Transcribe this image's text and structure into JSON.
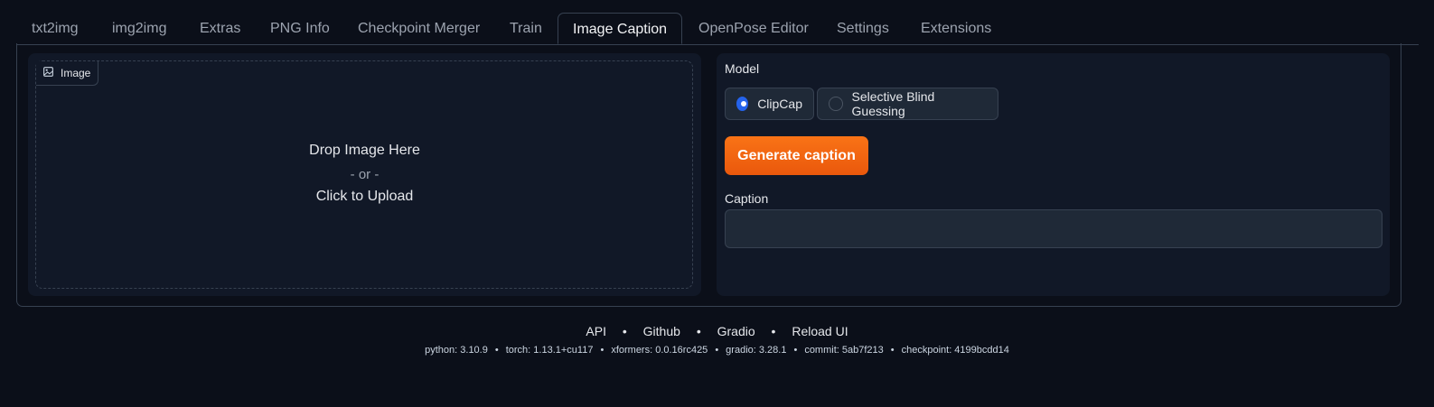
{
  "tabs": [
    {
      "label": "txt2img"
    },
    {
      "label": "img2img"
    },
    {
      "label": "Extras"
    },
    {
      "label": "PNG Info"
    },
    {
      "label": "Checkpoint Merger"
    },
    {
      "label": "Train"
    },
    {
      "label": "Image Caption",
      "active": true
    },
    {
      "label": "OpenPose Editor"
    },
    {
      "label": "Settings"
    },
    {
      "label": "Extensions"
    }
  ],
  "image_input": {
    "label": "Image",
    "drop_text": "Drop Image Here",
    "or_text": "- or -",
    "upload_text": "Click to Upload"
  },
  "model": {
    "label": "Model",
    "options": [
      {
        "label": "ClipCap",
        "checked": true
      },
      {
        "label": "Selective Blind Guessing",
        "checked": false
      }
    ]
  },
  "generate_button": "Generate caption",
  "caption": {
    "label": "Caption",
    "value": ""
  },
  "footer": {
    "links": [
      "API",
      "Github",
      "Gradio",
      "Reload UI"
    ],
    "separator": "•",
    "versions": [
      "python: 3.10.9",
      "torch: 1.13.1+cu117",
      "xformers: 0.0.16rc425",
      "gradio: 3.28.1",
      "commit: 5ab7f213",
      "checkpoint: 4199bcdd14"
    ]
  },
  "colors": {
    "accent": "#ea580c",
    "radio_checked": "#2563eb",
    "background": "#0b0f19",
    "panel": "#111827"
  }
}
